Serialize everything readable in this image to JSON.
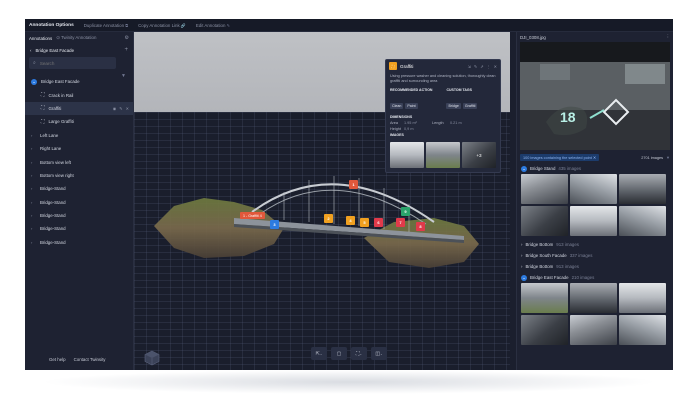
{
  "topbar": {
    "title": "Annotation Options",
    "items": [
      "Duplicate Annotation",
      "Copy Annotation Link",
      "Edit Annotation"
    ]
  },
  "left": {
    "header": {
      "title": "Annotations",
      "twin": "Twinity Annotation"
    },
    "crumb": "Bridge East Facade",
    "search_placeholder": "Search",
    "tree": [
      {
        "label": "Bridge East Facade",
        "expanded": true
      },
      {
        "label": "Crack in Rail",
        "child": true
      },
      {
        "label": "Graffiti",
        "child": true,
        "selected": true
      },
      {
        "label": "Large Graffiti",
        "child": true
      },
      {
        "label": "Left Lane"
      },
      {
        "label": "Right Lane"
      },
      {
        "label": "Bottom view left"
      },
      {
        "label": "Bottom view right"
      },
      {
        "label": "Bridge-Stand"
      },
      {
        "label": "Bridge-Stand"
      },
      {
        "label": "Bridge-Stand"
      },
      {
        "label": "Bridge-Stand"
      },
      {
        "label": "Bridge-Stand"
      }
    ],
    "footer": {
      "help": "Get help",
      "contact": "Contact Twinsity"
    }
  },
  "popup": {
    "title": "Graffiti",
    "description": "Using pressure washer and cleaning solution, thoroughly clean graffiti and surrounding area",
    "action_head": "RECOMMENDED ACTION",
    "actions": [
      "Clean",
      "Paint"
    ],
    "tags_head": "CUSTOM TAGS",
    "tags": [
      "Bridge",
      "Graffiti"
    ],
    "dims_head": "DIMENSIONS",
    "area_label": "Area",
    "area": "1.95 m²",
    "length_label": "Length",
    "length": "0.21 m",
    "height_label": "Height",
    "height": "0,9 m",
    "images_head": "IMAGES",
    "more": "+3"
  },
  "viewport": {
    "label": "1 - Graffiti 4",
    "markers": [
      {
        "text": "1",
        "color": "#e1583b"
      },
      {
        "text": "2",
        "color": "#f0a020"
      },
      {
        "text": "3",
        "color": "#2d7be0"
      },
      {
        "text": "4",
        "color": "#f0a020"
      },
      {
        "text": "5",
        "color": "#f0a020"
      },
      {
        "text": "6",
        "color": "#e03a4a"
      },
      {
        "text": "7",
        "color": "#e03a4a"
      },
      {
        "text": "8",
        "color": "#e03a4a"
      },
      {
        "text": "9",
        "color": "#2aa36b"
      }
    ]
  },
  "right": {
    "file": "DJI_0308.jpg",
    "note": "100 images containing the selected point",
    "count": "2701 images",
    "groups": [
      {
        "label": "Bridge Stand",
        "count": "435 images",
        "expanded": true
      },
      {
        "label": "Bridge Bottom",
        "count": "913 images"
      },
      {
        "label": "Bridge South Facade",
        "count": "337 images"
      },
      {
        "label": "Bridge Bottom",
        "count": "913 images"
      },
      {
        "label": "Bridge East Facade",
        "count": "210 images",
        "expanded": true
      }
    ]
  }
}
